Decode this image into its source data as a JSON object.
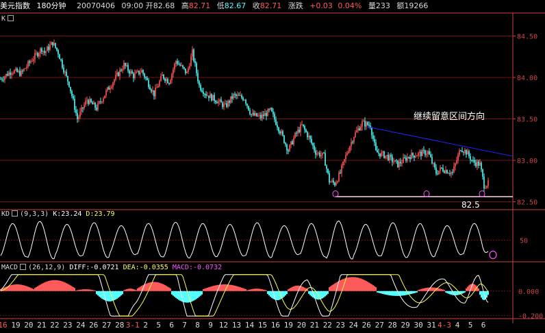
{
  "header": {
    "symbol": "美元指数",
    "period": "180分钟",
    "date": "20070406",
    "time": "09:00",
    "open_label": "开",
    "open": "82.68",
    "high_label": "高",
    "high": "82.71",
    "low_label": "低",
    "low": "82.67",
    "close_label": "收",
    "close": "82.71",
    "change_label": "涨跌",
    "change": "+0.03",
    "change_pct": "0.04%",
    "volume_label": "量",
    "volume": "233",
    "amount_label": "额",
    "amount": "19266"
  },
  "colors": {
    "up": "#ff5a5a",
    "down": "#54ffff",
    "k_line": "#ffffff",
    "d_line": "#ffff55",
    "trend": "#2222ff",
    "support": "#ffd6e6",
    "grid": "#7a1010",
    "axis": "#cc4444",
    "macd_text": "#ff55ff",
    "dea_text": "#ffff55"
  },
  "panels": {
    "k": {
      "label": "K"
    },
    "kd": {
      "name": "KD",
      "params": "(9,3,3)",
      "k_text": "K:23.24",
      "d_text": "D:23.79"
    },
    "macd": {
      "name": "MACD",
      "params": "(26,12,9)",
      "diff_text": "DIFF:-0.0721",
      "dea_text": "DEA:-0.0355",
      "macd_text": "MACD:-0.0732"
    }
  },
  "annotations": {
    "note": "继续留意区间方向",
    "support_value": "82.5"
  },
  "x_axis_labels": [
    "16",
    "19",
    "20",
    "21",
    "22",
    "23",
    "24",
    "26",
    "27",
    "28",
    "3-1",
    "2",
    "5",
    "6",
    "7",
    "8",
    "9",
    "12",
    "13",
    "14",
    "15",
    "16",
    "19",
    "20",
    "21",
    "22",
    "23",
    "24",
    "26",
    "27",
    "28",
    "29",
    "30",
    "31",
    "4-3",
    "4",
    "5",
    "6"
  ],
  "chart_data": [
    {
      "type": "candlestick",
      "y_ticks": [
        "84.50",
        "84.00",
        "83.50",
        "83.00",
        "82.50"
      ],
      "ylim": [
        82.43,
        84.62
      ],
      "candles_count": 180,
      "close_anchors": [
        [
          0,
          83.98
        ],
        [
          8,
          84.08
        ],
        [
          15,
          84.05
        ],
        [
          22,
          84.2
        ],
        [
          30,
          84.35
        ],
        [
          32,
          84.3
        ],
        [
          38,
          84.42
        ],
        [
          42,
          84.3
        ],
        [
          48,
          84.0
        ],
        [
          50,
          83.92
        ],
        [
          56,
          83.5
        ],
        [
          63,
          83.73
        ],
        [
          70,
          83.63
        ],
        [
          78,
          83.85
        ],
        [
          90,
          84.15
        ],
        [
          97,
          84.02
        ],
        [
          103,
          84.08
        ],
        [
          112,
          83.8
        ],
        [
          118,
          84.02
        ],
        [
          123,
          83.95
        ],
        [
          128,
          84.2
        ],
        [
          136,
          84.05
        ],
        [
          140,
          84.3
        ],
        [
          145,
          83.9
        ],
        [
          150,
          83.8
        ],
        [
          158,
          83.72
        ],
        [
          164,
          83.65
        ],
        [
          170,
          83.78
        ],
        [
          178,
          83.75
        ],
        [
          183,
          83.55
        ],
        [
          190,
          83.52
        ],
        [
          197,
          83.6
        ],
        [
          205,
          83.32
        ],
        [
          210,
          83.12
        ],
        [
          215,
          83.3
        ],
        [
          220,
          83.42
        ],
        [
          225,
          83.28
        ],
        [
          230,
          83.1
        ],
        [
          236,
          83.05
        ],
        [
          240,
          82.75
        ],
        [
          244,
          82.72
        ],
        [
          248,
          82.85
        ],
        [
          253,
          83.1
        ],
        [
          258,
          83.3
        ],
        [
          264,
          83.45
        ],
        [
          270,
          83.42
        ],
        [
          274,
          83.1
        ],
        [
          282,
          83.05
        ],
        [
          290,
          82.95
        ],
        [
          298,
          83.05
        ],
        [
          306,
          83.08
        ],
        [
          312,
          83.1
        ],
        [
          318,
          82.85
        ],
        [
          322,
          82.9
        ],
        [
          330,
          82.85
        ],
        [
          336,
          83.15
        ],
        [
          340,
          83.1
        ],
        [
          345,
          82.98
        ],
        [
          350,
          82.95
        ],
        [
          353,
          82.7
        ],
        [
          356,
          82.72
        ]
      ],
      "low_min": 82.68,
      "high_max": 84.48
    },
    {
      "type": "line",
      "title": "KD(9,3,3)",
      "y_ticks": [
        "50"
      ],
      "ylim": [
        0,
        100
      ],
      "series": [
        {
          "name": "K",
          "cycle_peaks": [
            90,
            95,
            88,
            92,
            85,
            90,
            93,
            90,
            88,
            92,
            85,
            90,
            96,
            88,
            92,
            90,
            85,
            90
          ],
          "last_value": 23.24
        },
        {
          "name": "D",
          "cycle_peaks": [
            85,
            90,
            85,
            88,
            82,
            86,
            90,
            86,
            85,
            88,
            82,
            86,
            92,
            85,
            88,
            86,
            82,
            86
          ],
          "last_value": 23.79
        }
      ]
    },
    {
      "type": "bar",
      "title": "MACD(26,12,9)",
      "y_ticks": [
        "0.000",
        "-0.200"
      ],
      "ylim": [
        -0.215,
        0.145
      ],
      "segments": [
        {
          "from": 0,
          "to": 25,
          "value": 0.055
        },
        {
          "from": 25,
          "to": 55,
          "value": 0.09
        },
        {
          "from": 55,
          "to": 70,
          "value": 0.015
        },
        {
          "from": 70,
          "to": 90,
          "value": -0.085
        },
        {
          "from": 90,
          "to": 100,
          "value": 0.02
        },
        {
          "from": 100,
          "to": 125,
          "value": 0.075
        },
        {
          "from": 125,
          "to": 148,
          "value": -0.095
        },
        {
          "from": 148,
          "to": 180,
          "value": 0.055
        },
        {
          "from": 180,
          "to": 195,
          "value": 0.02
        },
        {
          "from": 195,
          "to": 210,
          "value": -0.075
        },
        {
          "from": 210,
          "to": 225,
          "value": 0.045
        },
        {
          "from": 225,
          "to": 240,
          "value": -0.07
        },
        {
          "from": 240,
          "to": 275,
          "value": 0.115
        },
        {
          "from": 275,
          "to": 305,
          "value": -0.04
        },
        {
          "from": 305,
          "to": 325,
          "value": 0.03
        },
        {
          "from": 325,
          "to": 340,
          "value": -0.035
        },
        {
          "from": 340,
          "to": 350,
          "value": 0.06
        },
        {
          "from": 350,
          "to": 357,
          "value": -0.075
        }
      ],
      "series": [
        {
          "name": "DIFF",
          "last_value": -0.0721
        },
        {
          "name": "DEA",
          "last_value": -0.0355
        },
        {
          "name": "MACD",
          "last_value": -0.0732
        }
      ]
    }
  ]
}
